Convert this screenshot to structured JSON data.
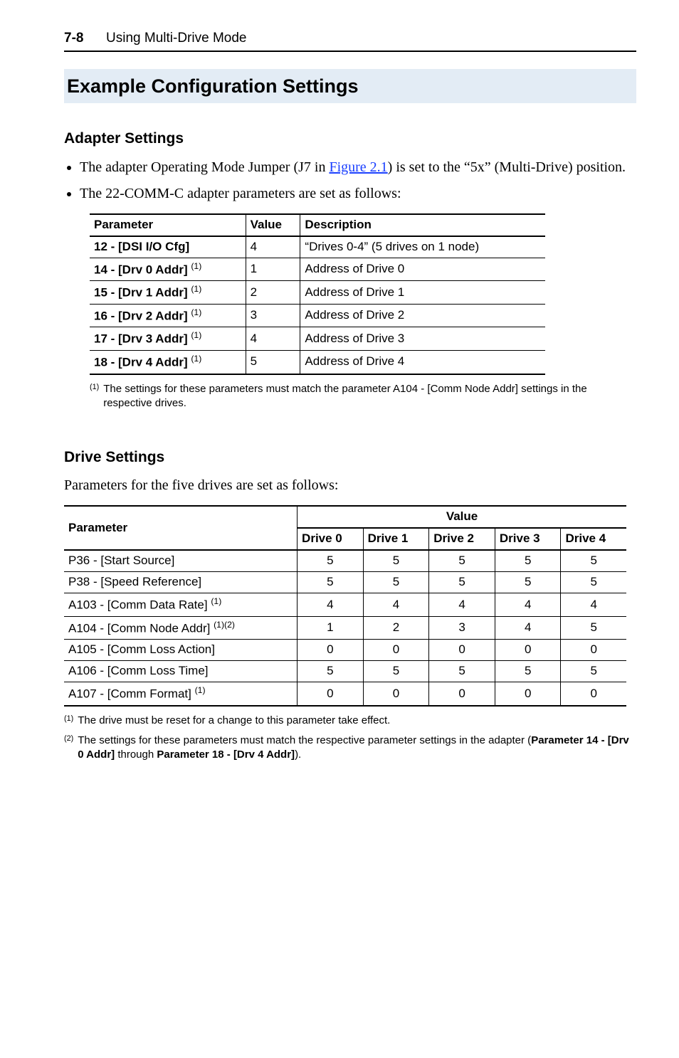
{
  "header": {
    "page_num": "7-8",
    "section": "Using Multi-Drive Mode"
  },
  "h1": "Example Configuration Settings",
  "adapter": {
    "heading": "Adapter Settings",
    "bullet1_pre": "The adapter Operating Mode Jumper (J7 in ",
    "bullet1_link": "Figure 2.1",
    "bullet1_post": ") is set to the “5x” (Multi-Drive) position.",
    "bullet2": "The 22-COMM-C adapter parameters are set as follows:",
    "th_param": "Parameter",
    "th_value": "Value",
    "th_desc": "Description",
    "rows": [
      {
        "param": "12 - [DSI I/O Cfg]",
        "sup": "",
        "value": "4",
        "desc": "“Drives 0-4” (5 drives on 1 node)"
      },
      {
        "param": "14 - [Drv 0 Addr] ",
        "sup": "(1)",
        "value": "1",
        "desc": "Address of Drive 0"
      },
      {
        "param": "15 - [Drv 1 Addr] ",
        "sup": "(1)",
        "value": "2",
        "desc": "Address of Drive 1"
      },
      {
        "param": "16 - [Drv 2 Addr] ",
        "sup": "(1)",
        "value": "3",
        "desc": "Address of Drive 2"
      },
      {
        "param": "17 - [Drv 3 Addr] ",
        "sup": "(1)",
        "value": "4",
        "desc": "Address of Drive 3"
      },
      {
        "param": "18 - [Drv 4 Addr] ",
        "sup": "(1)",
        "value": "5",
        "desc": "Address of Drive 4"
      }
    ],
    "fn1_num": "(1)",
    "fn1_txt": "The settings for these parameters must match the parameter A104 - [Comm Node Addr] settings in the respective drives."
  },
  "drive": {
    "heading": "Drive Settings",
    "intro": "Parameters for the five drives are set as follows:",
    "th_param": "Parameter",
    "th_value": "Value",
    "th_d0": "Drive 0",
    "th_d1": "Drive 1",
    "th_d2": "Drive 2",
    "th_d3": "Drive 3",
    "th_d4": "Drive 4",
    "rows": [
      {
        "param": "P36 - [Start Source]",
        "sup": "",
        "v": [
          "5",
          "5",
          "5",
          "5",
          "5"
        ]
      },
      {
        "param": "P38 - [Speed Reference]",
        "sup": "",
        "v": [
          "5",
          "5",
          "5",
          "5",
          "5"
        ]
      },
      {
        "param": "A103 - [Comm Data Rate] ",
        "sup": "(1)",
        "v": [
          "4",
          "4",
          "4",
          "4",
          "4"
        ]
      },
      {
        "param": "A104 - [Comm Node Addr] ",
        "sup": "(1)(2)",
        "v": [
          "1",
          "2",
          "3",
          "4",
          "5"
        ]
      },
      {
        "param": "A105 - [Comm Loss Action]",
        "sup": "",
        "v": [
          "0",
          "0",
          "0",
          "0",
          "0"
        ]
      },
      {
        "param": "A106 - [Comm Loss Time]",
        "sup": "",
        "v": [
          "5",
          "5",
          "5",
          "5",
          "5"
        ]
      },
      {
        "param": "A107 - [Comm Format] ",
        "sup": "(1)",
        "v": [
          "0",
          "0",
          "0",
          "0",
          "0"
        ]
      }
    ],
    "fn1_num": "(1)",
    "fn1_txt": "The drive must be reset for a change to this parameter take effect.",
    "fn2_num": "(2)",
    "fn2_txt_pre": "The settings for these parameters must match the respective parameter settings in the adapter (",
    "fn2_bold1": "Parameter 14 - [Drv 0 Addr]",
    "fn2_mid": " through ",
    "fn2_bold2": "Parameter 18 - [Drv 4 Addr]",
    "fn2_post": ")."
  }
}
